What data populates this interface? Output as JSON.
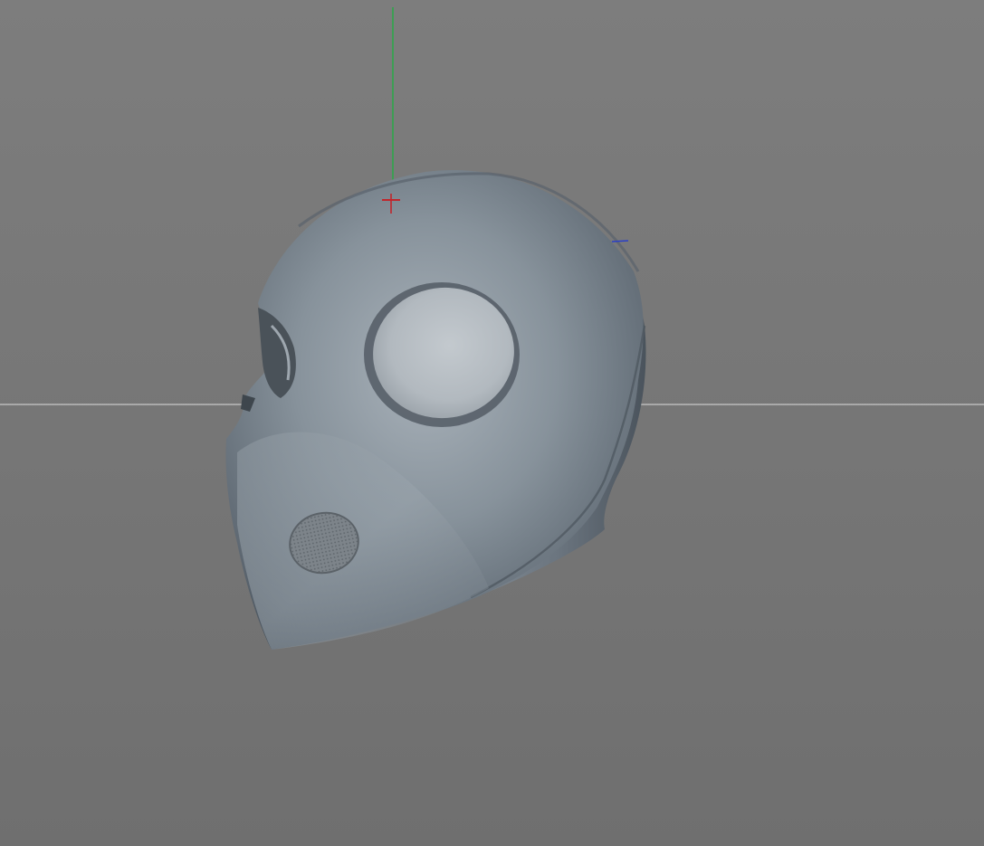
{
  "viewport": {
    "background": "#787878",
    "horizon_color": "#c8c8c8"
  },
  "axes": {
    "y_axis_color": "#2fa64a",
    "x_axis_color": "#c0262c",
    "z_axis_color": "#2a3fc8"
  },
  "model": {
    "icon": "helmet-mask-model",
    "base_color": "#7c8791",
    "shadow_color": "#3e454c",
    "highlight_color": "#aab3bb",
    "eye_patch_color": "#b8bfc5",
    "mouth_vent_color": "#80868c"
  }
}
